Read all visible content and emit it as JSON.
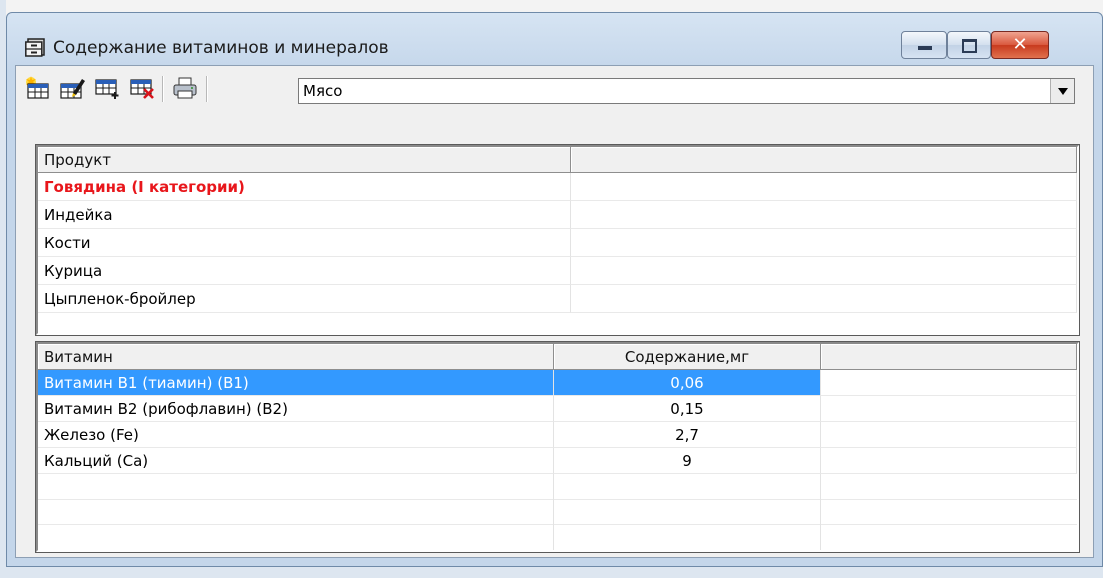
{
  "window": {
    "title": "Содержание витаминов и минералов",
    "close_glyph": "✕"
  },
  "toolbar": {
    "buttons": [
      "add-record",
      "edit-record",
      "add-row",
      "delete-row",
      "print"
    ],
    "category": {
      "value": "Мясо"
    }
  },
  "products": {
    "columns": [
      "Продукт",
      ""
    ],
    "rows": [
      {
        "name": "Говядина (I категории)",
        "highlight": true
      },
      {
        "name": "Индейка"
      },
      {
        "name": "Кости"
      },
      {
        "name": "Курица"
      },
      {
        "name": "Цыпленок-бройлер"
      }
    ]
  },
  "vitamins": {
    "columns": [
      "Витамин",
      "Содержание,мг",
      ""
    ],
    "rows": [
      {
        "name": "Витамин В1 (тиамин) (В1)",
        "amount": "0,06",
        "selected": true
      },
      {
        "name": "Витамин В2 (рибофлавин) (В2)",
        "amount": "0,15"
      },
      {
        "name": "Железо (Fe)",
        "amount": "2,7"
      },
      {
        "name": "Кальций (Ca)",
        "amount": "9"
      }
    ]
  },
  "colors": {
    "highlight_text": "#e8161b",
    "selection": "#3399ff",
    "close_button": "#c83a1e"
  }
}
